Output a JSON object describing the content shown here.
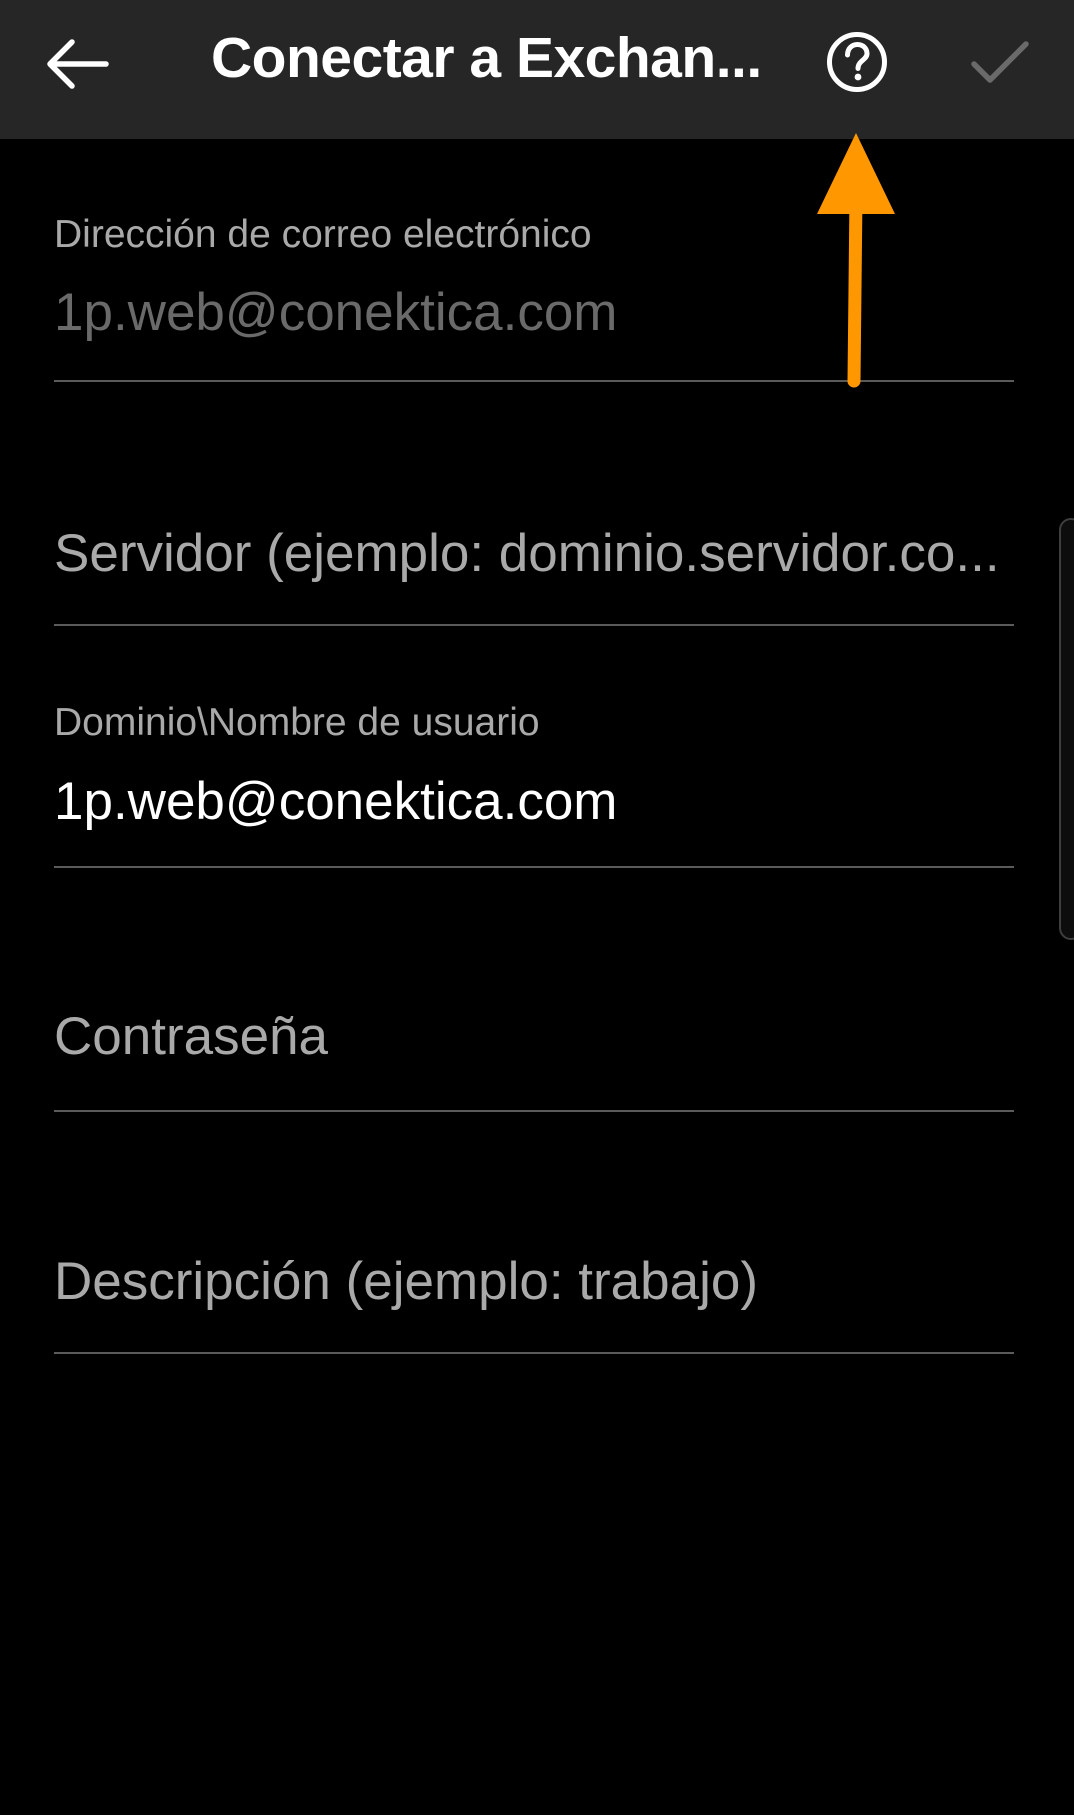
{
  "app_bar": {
    "title": "Conectar a Exchan...",
    "back_icon": "arrow-left-icon",
    "help_icon": "help-circle-icon",
    "confirm_icon": "checkmark-icon"
  },
  "form": {
    "email": {
      "label": "Dirección de correo electrónico",
      "value": "1p.web@conektica.com"
    },
    "server": {
      "placeholder": "Servidor (ejemplo: dominio.servidor.co..."
    },
    "username": {
      "label": "Dominio\\Nombre de usuario",
      "value": "1p.web@conektica.com"
    },
    "password": {
      "placeholder": "Contraseña"
    },
    "description": {
      "placeholder": "Descripción (ejemplo: trabajo)"
    }
  },
  "annotation": {
    "arrow_color": "#FF9800"
  },
  "colors": {
    "background": "#000000",
    "app_bar": "#262626",
    "divider": "#5A5A5A",
    "label": "#A9A9A9",
    "disabled_text": "#6A6A6A",
    "text": "#FFFFFF"
  }
}
